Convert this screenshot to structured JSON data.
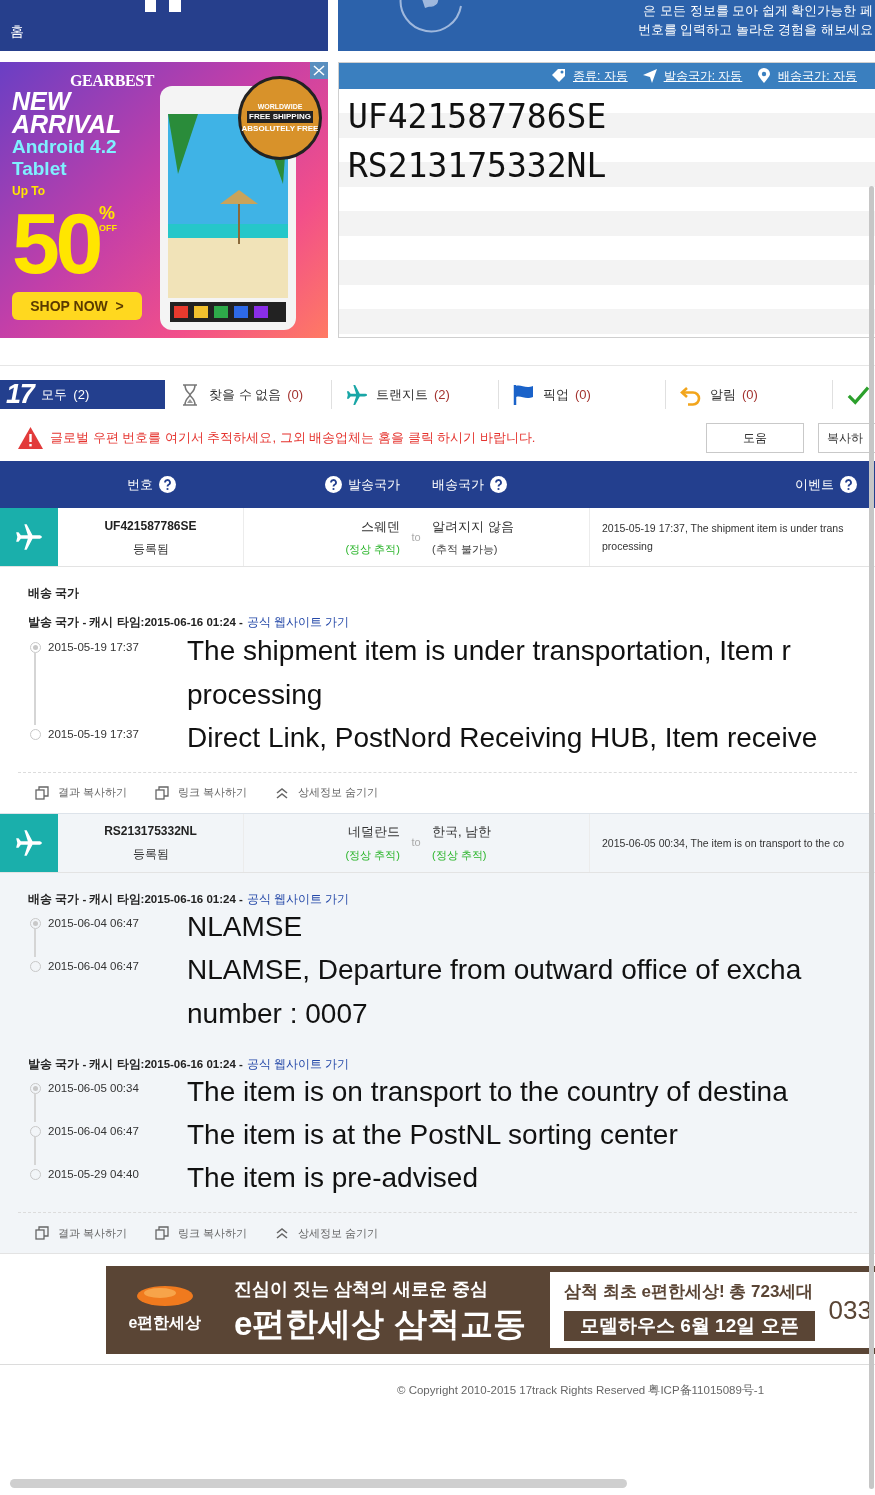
{
  "header": {
    "home_label": "홈",
    "intro_lines": [
      "은 모든 정보를 모아 쉽게 확인가능한 페",
      "번호를 입력하고 놀라운 경험을 해보세요"
    ]
  },
  "ad_top": {
    "brand": "GEARBEST",
    "headline": [
      "NEW",
      "ARRIVAL"
    ],
    "subline": [
      "Android 4.2",
      "Tablet"
    ],
    "up_to": "Up To",
    "discount": "50",
    "percent": "%",
    "off": "OFF",
    "cta": "SHOP NOW  >",
    "badge": [
      "WORLDWIDE",
      "FREE SHIPPING",
      "ABSOLUTELY FREE"
    ]
  },
  "tracking_input": {
    "options": [
      {
        "kind": "tag",
        "label": "종류: 자동"
      },
      {
        "kind": "send",
        "label": "발송국가: 자동"
      },
      {
        "kind": "pin",
        "label": "배송국가: 자동"
      }
    ],
    "numbers": [
      "UF421587786SE",
      "RS213175332NL"
    ]
  },
  "logo": "17",
  "filters": [
    {
      "kind": "all",
      "label": "모두",
      "count": "(2)",
      "selected": true
    },
    {
      "kind": "notfound",
      "label": "찾을 수 없음",
      "count": "(0)",
      "selected": false
    },
    {
      "kind": "transit",
      "label": "트랜지트",
      "count": "(2)",
      "selected": false
    },
    {
      "kind": "pickup",
      "label": "픽업",
      "count": "(0)",
      "selected": false
    },
    {
      "kind": "alert",
      "label": "알림",
      "count": "(0)",
      "selected": false
    },
    {
      "kind": "delivered",
      "selected": false
    }
  ],
  "notice": {
    "text": "글로벌 우편 번호를 여기서 추적하세요, 그외 배송업체는 홈을 클릭 하시기 바랍니다.",
    "buttons": [
      "도움",
      "복사하"
    ]
  },
  "table": {
    "columns": [
      "번호",
      "발송국가",
      "배송국가",
      "이벤트"
    ],
    "shipments": [
      {
        "number": "UF421587786SE",
        "status": "등록됨",
        "selected": false,
        "origin": {
          "country": "스웨덴",
          "tracking": "(정상 추적)",
          "ok": true
        },
        "to": "to",
        "destination": {
          "country": "알려지지 않음",
          "tracking": "(추적 불가능)",
          "ok": false
        },
        "latest": [
          "2015-05-19 17:37, The shipment item is under trans",
          "processing"
        ],
        "sections": [
          {
            "caption": "배송 국가"
          },
          {
            "caption": "발송 국가 - 캐시 타임:2015-06-16 01:24 -",
            "link": "공식 웹사이트 가기",
            "events": [
              {
                "time": "2015-05-19 17:37",
                "current": true,
                "lines": [
                  "The shipment item is under transportation, Item r",
                  "processing"
                ]
              },
              {
                "time": "2015-05-19 17:37",
                "current": false,
                "lines": [
                  "Direct Link, PostNord Receiving HUB, Item receive"
                ]
              }
            ]
          }
        ],
        "actions": [
          {
            "kind": "copy",
            "label": "결과 복사하기"
          },
          {
            "kind": "copy",
            "label": "링크 복사하기"
          },
          {
            "kind": "collapse",
            "label": "상세정보 숨기기"
          }
        ]
      },
      {
        "number": "RS213175332NL",
        "status": "등록됨",
        "selected": true,
        "origin": {
          "country": "네덜란드",
          "tracking": "(정상 추적)",
          "ok": true
        },
        "to": "to",
        "destination": {
          "country": "한국, 남한",
          "tracking": "(정상 추적)",
          "ok": true
        },
        "latest": [
          "2015-06-05 00:34, The item is on transport to the co"
        ],
        "sections": [
          {
            "caption": "배송 국가 - 캐시 타임:2015-06-16 01:24 -",
            "link": "공식 웹사이트 가기",
            "events": [
              {
                "time": "2015-06-04 06:47",
                "current": true,
                "lines": [
                  "NLAMSE"
                ]
              },
              {
                "time": "2015-06-04 06:47",
                "current": false,
                "lines": [
                  "NLAMSE, Departure from outward office of excha",
                  "number : 0007"
                ]
              }
            ]
          },
          {
            "caption": "발송 국가 - 캐시 타임:2015-06-16 01:24 -",
            "link": "공식 웹사이트 가기",
            "events": [
              {
                "time": "2015-06-05 00:34",
                "current": true,
                "lines": [
                  "The item is on transport to the country of destina"
                ]
              },
              {
                "time": "2015-06-04 06:47",
                "current": false,
                "lines": [
                  "The item is at the PostNL sorting center"
                ]
              },
              {
                "time": "2015-05-29 04:40",
                "current": false,
                "lines": [
                  "The item is pre-advised"
                ]
              }
            ]
          }
        ],
        "actions": [
          {
            "kind": "copy",
            "label": "결과 복사하기"
          },
          {
            "kind": "copy",
            "label": "링크 복사하기"
          },
          {
            "kind": "collapse",
            "label": "상세정보 숨기기"
          }
        ]
      }
    ]
  },
  "ad_bottom": {
    "logo_text": "e편한세상",
    "tagline": "진심이 짓는 삼척의 새로운 중심",
    "title": "e편한세상 삼척교동",
    "info": "삼척 최초 e편한세상! 총 723세대",
    "opening": "모델하우스 6월 12일 오픈",
    "phone": "033"
  },
  "footer": "© Copyright 2010-2015 17track Rights Reserved 粤ICP备11015089号-1"
}
